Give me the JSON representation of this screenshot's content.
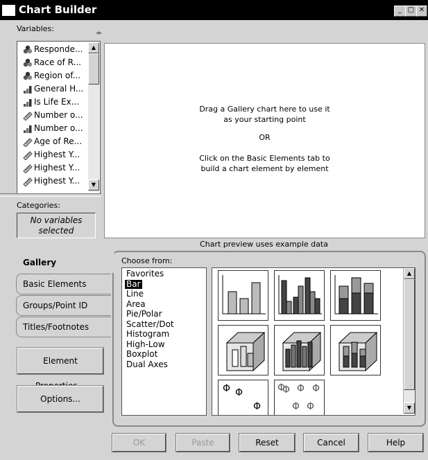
{
  "window": {
    "title": "Chart Builder"
  },
  "variables": {
    "label": "Variables:",
    "items": [
      {
        "label": "Responde...",
        "icon": "nominal-icon"
      },
      {
        "label": "Race of R...",
        "icon": "nominal-icon"
      },
      {
        "label": "Region of...",
        "icon": "nominal-icon"
      },
      {
        "label": "General H...",
        "icon": "ordinal-icon"
      },
      {
        "label": "Is Life Ex...",
        "icon": "ordinal-icon"
      },
      {
        "label": "Number o...",
        "icon": "scale-icon"
      },
      {
        "label": "Number o...",
        "icon": "ordinal-icon"
      },
      {
        "label": "Age of Re...",
        "icon": "scale-icon"
      },
      {
        "label": "Highest Y...",
        "icon": "scale-icon"
      },
      {
        "label": "Highest Y...",
        "icon": "scale-icon"
      },
      {
        "label": "Highest Y...",
        "icon": "scale-icon"
      }
    ]
  },
  "categories": {
    "label": "Categories:",
    "empty_text": "No variables selected"
  },
  "canvas": {
    "instruction_1": "Drag a Gallery chart here to use it as your starting point",
    "or_text": "OR",
    "instruction_2": "Click on the Basic Elements tab to build a chart element by element",
    "preview_note": "Chart preview uses example data"
  },
  "tabs": [
    "Gallery",
    "Basic Elements",
    "Groups/Point ID",
    "Titles/Footnotes"
  ],
  "side_buttons": {
    "element_properties": "Element Properties...",
    "options": "Options..."
  },
  "gallery": {
    "choose_label": "Choose from:",
    "chart_types": [
      "Favorites",
      "Bar",
      "Line",
      "Area",
      "Pie/Polar",
      "Scatter/Dot",
      "Histogram",
      "High-Low",
      "Boxplot",
      "Dual Axes"
    ],
    "selected": "Bar",
    "thumbnail_glyph": "Φ"
  },
  "dialog_buttons": {
    "ok": "OK",
    "paste": "Paste",
    "reset": "Reset",
    "cancel": "Cancel",
    "help": "Help"
  }
}
